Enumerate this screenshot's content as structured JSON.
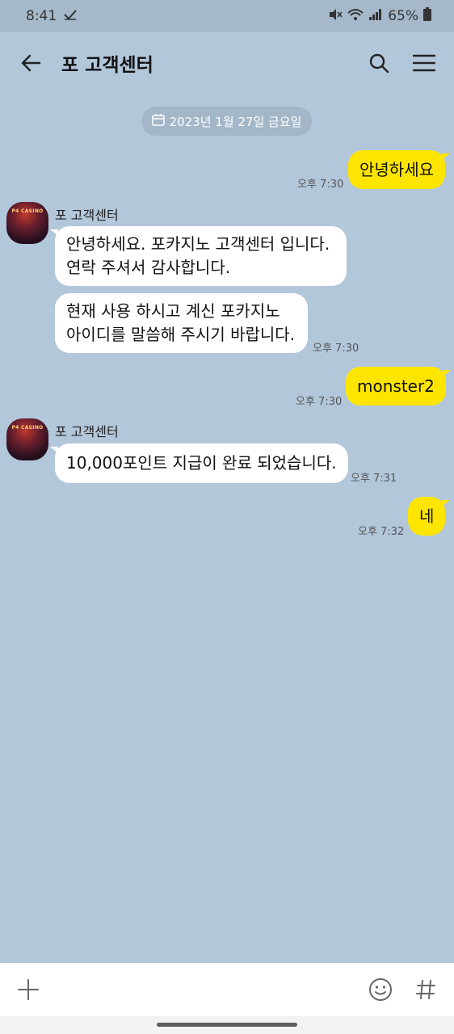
{
  "status_bar": {
    "time": "8:41",
    "battery": "65%"
  },
  "header": {
    "title": "포 고객센터"
  },
  "date_divider": "2023년 1월 27일 금요일",
  "messages": [
    {
      "from": "me",
      "text": "안녕하세요",
      "time": "오후 7:30"
    },
    {
      "from": "them",
      "sender": "포 고객센터",
      "lines": [
        "안녕하세요. 포카지노 고객센터 입니다.",
        "연락 주셔서 감사합니다."
      ]
    },
    {
      "from": "them",
      "lines": [
        "현재 사용 하시고 계신 포카지노",
        "아이디를 말씀해 주시기 바랍니다."
      ],
      "time": "오후 7:30"
    },
    {
      "from": "me",
      "text": "monster2",
      "time": "오후 7:30"
    },
    {
      "from": "them",
      "sender": "포 고객센터",
      "text": "10,000포인트 지급이 완료 되었습니다.",
      "time": "오후 7:31"
    },
    {
      "from": "me",
      "text": "네",
      "time": "오후 7:32"
    }
  ],
  "avatar": {
    "label": "P4 CASINO"
  },
  "icons": {
    "back": "arrow-left-icon",
    "search": "search-icon",
    "menu": "hamburger-menu-icon",
    "add": "plus-icon",
    "emoji": "emoji-icon",
    "hashtag": "hashtag-icon",
    "calendar": "calendar-icon"
  },
  "colors": {
    "chat_background": "#b2c7da",
    "my_bubble": "#fee500",
    "their_bubble": "#ffffff"
  }
}
